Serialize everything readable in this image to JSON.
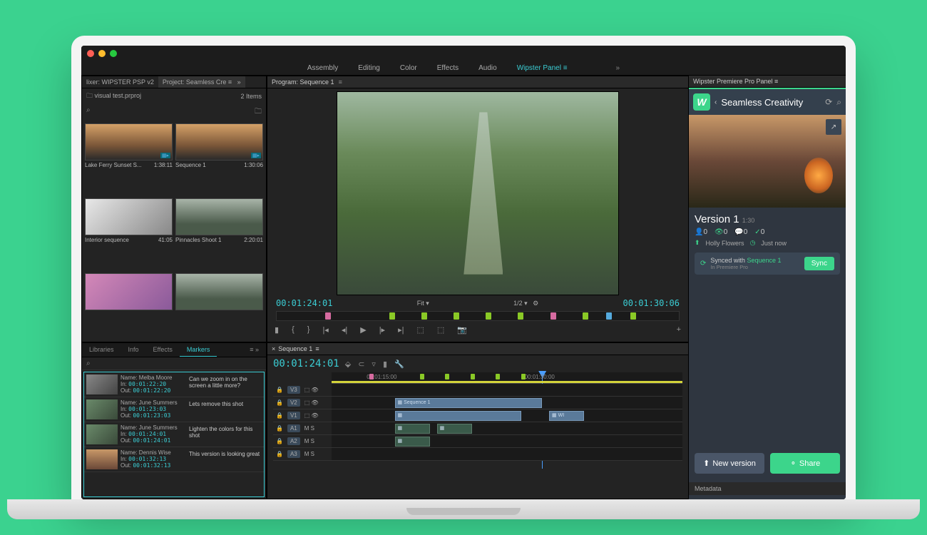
{
  "workspaces": {
    "items": [
      "Assembly",
      "Editing",
      "Color",
      "Effects",
      "Audio",
      "Wipster Panel"
    ],
    "active": "Wipster Panel"
  },
  "project": {
    "mixer": "lixer: WIPSTER PSP v2",
    "tab": "Project: Seamless Cre",
    "filename": "visual test.prproj",
    "item_count": "2 Items",
    "clips": [
      {
        "name": "Lake Ferry Sunset S...",
        "dur": "1:38:11",
        "cls": "sunset",
        "badge": true
      },
      {
        "name": "Sequence 1",
        "dur": "1:30:06",
        "cls": "sunset",
        "badge": true
      },
      {
        "name": "Interior sequence",
        "dur": "41:05",
        "cls": "interior"
      },
      {
        "name": "Pinnacles Shoot 1",
        "dur": "2:20:01",
        "cls": "mountain"
      },
      {
        "name": "",
        "dur": "",
        "cls": "pink"
      },
      {
        "name": "",
        "dur": "",
        "cls": "mountain"
      }
    ]
  },
  "program": {
    "title": "Program: Sequence 1",
    "tc_in": "00:01:24:01",
    "tc_out": "00:01:30:06",
    "fit": "Fit",
    "zoom": "1/2",
    "markers": [
      {
        "p": 12,
        "c": "p"
      },
      {
        "p": 28,
        "c": "g"
      },
      {
        "p": 36,
        "c": "g"
      },
      {
        "p": 44,
        "c": "g"
      },
      {
        "p": 52,
        "c": "g"
      },
      {
        "p": 60,
        "c": "g"
      },
      {
        "p": 68,
        "c": "p"
      },
      {
        "p": 76,
        "c": "g"
      },
      {
        "p": 82,
        "c": "c"
      },
      {
        "p": 88,
        "c": "g"
      }
    ]
  },
  "wipster": {
    "panel_title": "Wipster Premiere Pro Panel",
    "project": "Seamless Creativity",
    "version": "Version 1",
    "version_dur": "1:30",
    "people": "0",
    "views": "0",
    "comments": "0",
    "checks": "0",
    "uploader": "Holly Flowers",
    "when": "Just now",
    "sync_text": "Synced with",
    "sync_seq": "Sequence 1",
    "sync_sub": "In Premiere Pro",
    "sync_btn": "Sync",
    "new_version": "New version",
    "share": "Share",
    "metadata": "Metadata"
  },
  "markers_panel": {
    "tabs": [
      "Libraries",
      "Info",
      "Effects",
      "Markers"
    ],
    "active": "Markers",
    "items": [
      {
        "name": "Melba Moore",
        "in": "00:01:22:20",
        "out": "00:01:22:20",
        "cmt": "Can we zoom in on the screen a little more?",
        "cls": ""
      },
      {
        "name": "June Summers",
        "in": "00:01:23:03",
        "out": "00:01:23:03",
        "cmt": "Lets remove this shot",
        "cls": "m"
      },
      {
        "name": "June Summers",
        "in": "00:01:24:01",
        "out": "00:01:24:01",
        "cmt": "Lighten the colors for this shot",
        "cls": "m"
      },
      {
        "name": "Dennis Wise",
        "in": "00:01:32:13",
        "out": "00:01:32:13",
        "cmt": "This version is looking great",
        "cls": "s"
      }
    ]
  },
  "timeline": {
    "seq": "Sequence 1",
    "tc": "00:01:24:01",
    "ruler": [
      {
        "p": 10,
        "l": "00:01:15:00"
      },
      {
        "p": 55,
        "l": "00:01:30:00"
      }
    ],
    "tracks": [
      {
        "id": "V3",
        "type": "v",
        "clips": []
      },
      {
        "id": "V2",
        "type": "v",
        "clips": [
          {
            "l": 18,
            "w": 42,
            "lbl": "Sequence 1"
          }
        ]
      },
      {
        "id": "V1",
        "type": "v",
        "clips": [
          {
            "l": 18,
            "w": 36,
            "lbl": ""
          },
          {
            "l": 62,
            "w": 10,
            "lbl": "WI"
          }
        ]
      },
      {
        "id": "A1",
        "type": "a",
        "clips": [
          {
            "l": 18,
            "w": 10
          },
          {
            "l": 30,
            "w": 10
          }
        ]
      },
      {
        "id": "A2",
        "type": "a",
        "clips": [
          {
            "l": 18,
            "w": 10
          }
        ]
      },
      {
        "id": "A3",
        "type": "a",
        "clips": []
      }
    ]
  }
}
